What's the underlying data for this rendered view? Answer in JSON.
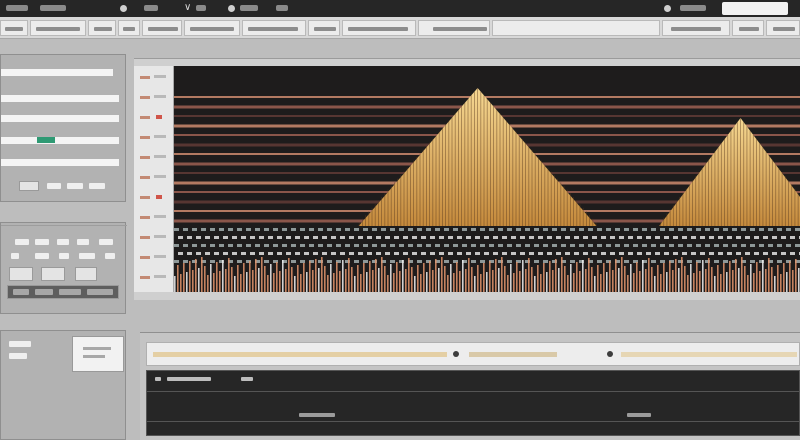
{
  "window": {
    "title": ""
  },
  "colors": {
    "titlebar": "#262626",
    "menubar": "#d8d8d8",
    "panel": "#b2b2b2",
    "waveform_bg": "#1e1c1c",
    "peak_gold": "#f0c878",
    "band_salmon": "#e59a7a",
    "accent_green": "#2f9a74",
    "console_bg": "#262626"
  },
  "icons": {
    "titlebar": [
      "circle-icon",
      "chevron-down-icon",
      "circle-icon",
      "circle-icon"
    ],
    "timeline": [
      "playhead-icon",
      "marker-icon"
    ]
  },
  "waveform": {
    "peaks": [
      {
        "center": 0.485,
        "height": 0.92,
        "halfwidth": 0.19
      },
      {
        "center": 0.905,
        "height": 0.72,
        "halfwidth": 0.13
      }
    ],
    "band_count": 14
  }
}
